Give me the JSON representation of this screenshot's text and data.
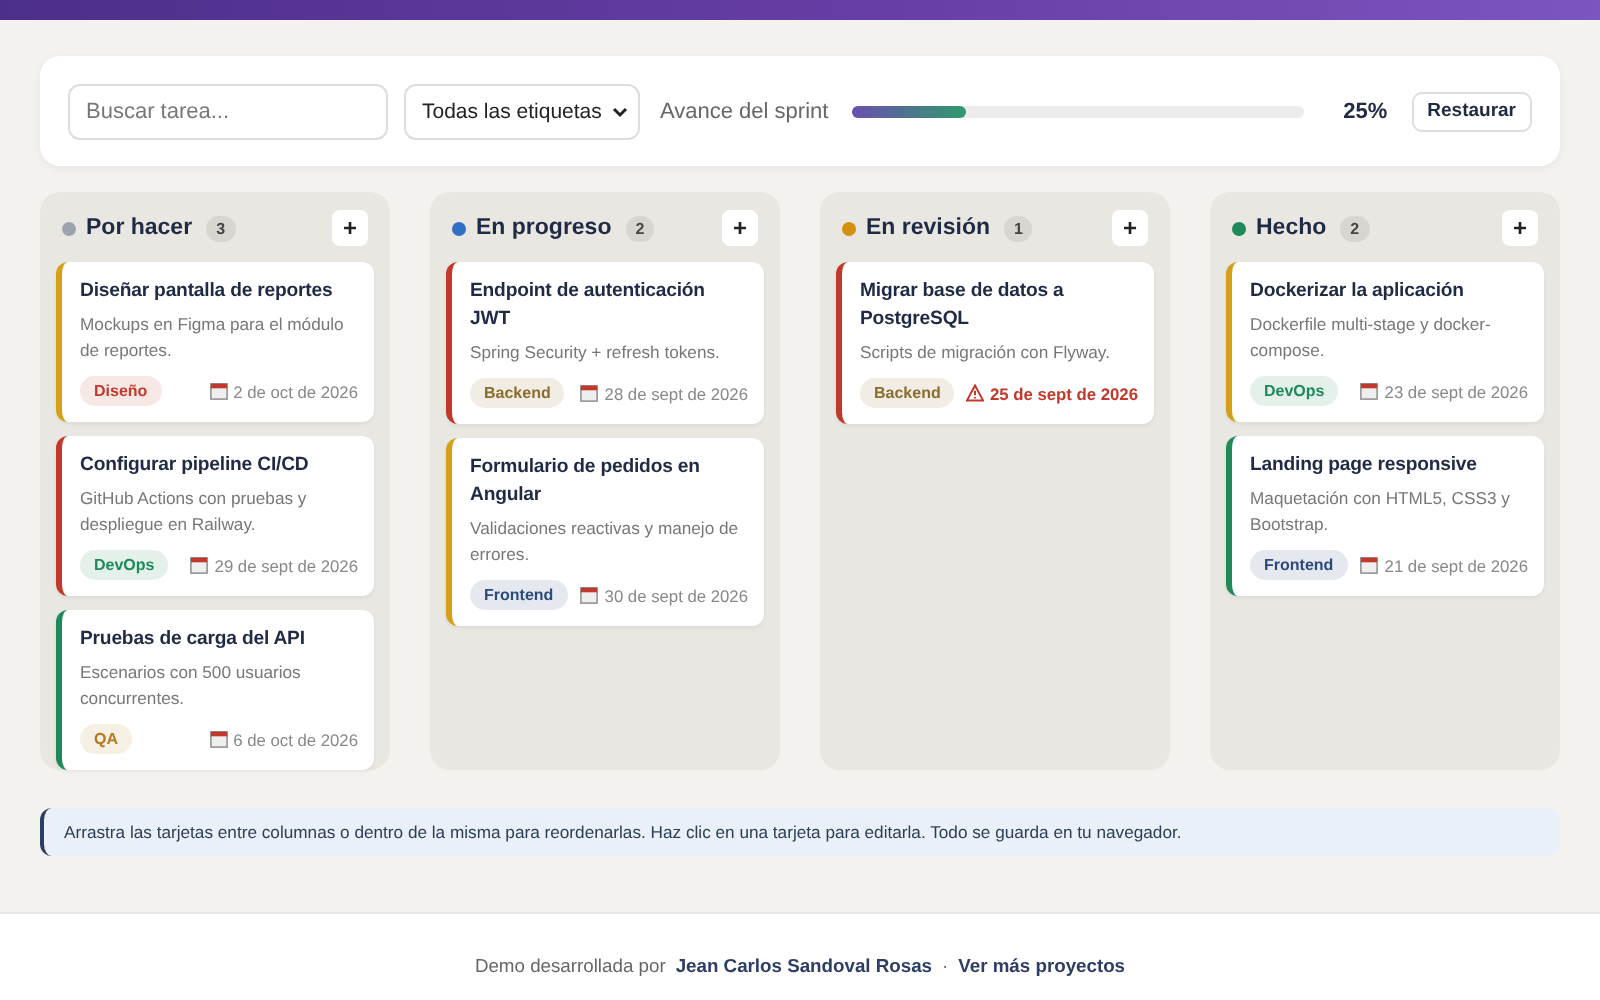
{
  "toolbar": {
    "search": {
      "placeholder": "Buscar tarea..."
    },
    "filter": {
      "value": "Todas las etiquetas"
    },
    "progress_label": "Avance del sprint",
    "progress": {
      "level": 0.25
    },
    "progress_text": "25%",
    "reset_button": "Restaurar"
  },
  "columns": [
    {
      "title": "Por hacer",
      "color": "#9ca3af",
      "count": "3",
      "add": "+",
      "cards": [
        {
          "title": "Diseñar pantalla de reportes",
          "description": "Mockups en Figma para el módulo de reportes.",
          "color": "#d4a017",
          "tag": {
            "label": "Diseño",
            "color": "#c0392b"
          },
          "due": "2 de oct de 2026",
          "overdue": false
        },
        {
          "title": "Configurar pipeline CI/CD",
          "description": "GitHub Actions con pruebas y despliegue en Railway.",
          "color": "#c0392b",
          "tag": {
            "label": "DevOps",
            "color": "#1e8a5a"
          },
          "due": "29 de sept de 2026",
          "overdue": false
        },
        {
          "title": "Pruebas de carga del API",
          "description": "Escenarios con 500 usuarios concurrentes.",
          "color": "#1e8a5a",
          "tag": {
            "label": "QA",
            "color": "#b7791f"
          },
          "due": "6 de oct de 2026",
          "overdue": false
        }
      ]
    },
    {
      "title": "En progreso",
      "color": "#2f6fc4",
      "count": "2",
      "add": "+",
      "cards": [
        {
          "title": "Endpoint de autenticación JWT",
          "description": "Spring Security + refresh tokens.",
          "color": "#c0392b",
          "tag": {
            "label": "Backend",
            "color": "#8a6d2b"
          },
          "due": "28 de sept de 2026",
          "overdue": false
        },
        {
          "title": "Formulario de pedidos en Angular",
          "description": "Validaciones reactivas y manejo de errores.",
          "color": "#d4a017",
          "tag": {
            "label": "Frontend",
            "color": "#2c4a7a"
          },
          "due": "30 de sept de 2026",
          "overdue": false
        }
      ]
    },
    {
      "title": "En revisión",
      "color": "#d4900f",
      "count": "1",
      "add": "+",
      "cards": [
        {
          "title": "Migrar base de datos a PostgreSQL",
          "description": "Scripts de migración con Flyway.",
          "color": "#c0392b",
          "tag": {
            "label": "Backend",
            "color": "#8a6d2b"
          },
          "due": "25 de sept de 2026",
          "overdue": true
        }
      ]
    },
    {
      "title": "Hecho",
      "color": "#1e8a5a",
      "count": "2",
      "add": "+",
      "cards": [
        {
          "title": "Dockerizar la aplicación",
          "description": "Dockerfile multi-stage y docker-compose.",
          "color": "#d4a017",
          "tag": {
            "label": "DevOps",
            "color": "#1e8a5a"
          },
          "due": "23 de sept de 2026",
          "overdue": false
        },
        {
          "title": "Landing page responsive",
          "description": "Maquetación con HTML5, CSS3 y Bootstrap.",
          "color": "#1e8a5a",
          "tag": {
            "label": "Frontend",
            "color": "#2c4a7a"
          },
          "due": "21 de sept de 2026",
          "overdue": false
        }
      ]
    }
  ],
  "hint": "Arrastra las tarjetas entre columnas o dentro de la misma para reordenarlas. Haz clic en una tarjeta para editarla. Todo se guarda en tu navegador.",
  "footer": {
    "credit": "Demo desarrollada por",
    "author_link": "Jean Carlos Sandoval Rosas",
    "separator": "·",
    "projects_link": "Ver más proyectos"
  }
}
